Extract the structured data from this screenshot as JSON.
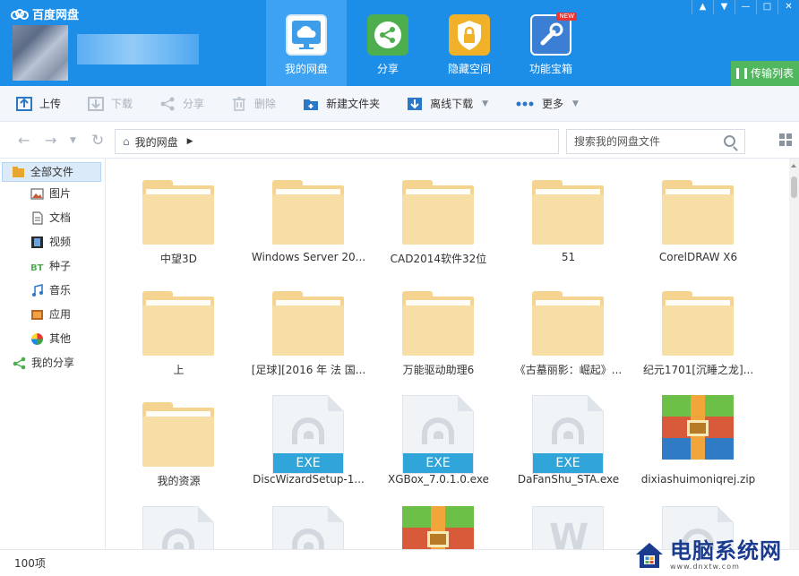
{
  "app": {
    "title": "百度网盘"
  },
  "nav": [
    {
      "label": "我的网盘",
      "icon": "cloud-icon",
      "active": true
    },
    {
      "label": "分享",
      "icon": "share-icon"
    },
    {
      "label": "隐藏空间",
      "icon": "lock-shield-icon"
    },
    {
      "label": "功能宝箱",
      "icon": "toolbox-icon",
      "badge": "NEW"
    }
  ],
  "window": {
    "transfer_label": "传输列表"
  },
  "toolbar": [
    {
      "label": "上传",
      "icon": "upload-icon",
      "enabled": true
    },
    {
      "label": "下载",
      "icon": "download-icon",
      "enabled": false
    },
    {
      "label": "分享",
      "icon": "share-icon",
      "enabled": false
    },
    {
      "label": "删除",
      "icon": "trash-icon",
      "enabled": false
    },
    {
      "label": "新建文件夹",
      "icon": "new-folder-icon",
      "enabled": true
    },
    {
      "label": "离线下载",
      "icon": "offline-download-icon",
      "enabled": true
    },
    {
      "label": "更多",
      "icon": "more-icon",
      "enabled": true
    }
  ],
  "breadcrumb": {
    "current": "我的网盘"
  },
  "search": {
    "placeholder": "搜索我的网盘文件"
  },
  "sidebar": [
    {
      "label": "全部文件",
      "icon": "all-files-icon",
      "level": "top",
      "selected": true
    },
    {
      "label": "图片",
      "icon": "image-icon",
      "level": "sub"
    },
    {
      "label": "文档",
      "icon": "document-icon",
      "level": "sub"
    },
    {
      "label": "视频",
      "icon": "video-icon",
      "level": "sub"
    },
    {
      "label": "种子",
      "icon": "bt-icon",
      "level": "sub"
    },
    {
      "label": "音乐",
      "icon": "music-icon",
      "level": "sub"
    },
    {
      "label": "应用",
      "icon": "app-icon",
      "level": "sub"
    },
    {
      "label": "其他",
      "icon": "other-icon",
      "level": "sub"
    },
    {
      "label": "我的分享",
      "icon": "my-share-icon",
      "level": "top"
    }
  ],
  "files": [
    {
      "name": "中望3D",
      "type": "folder"
    },
    {
      "name": "Windows Server 20...",
      "type": "folder"
    },
    {
      "name": "CAD2014软件32位",
      "type": "folder"
    },
    {
      "name": "51",
      "type": "folder"
    },
    {
      "name": "CorelDRAW X6",
      "type": "folder"
    },
    {
      "name": "上",
      "type": "folder"
    },
    {
      "name": "[足球][2016 年 法 国...",
      "type": "folder"
    },
    {
      "name": "万能驱动助理6",
      "type": "folder"
    },
    {
      "name": "《古墓丽影：崛起》...",
      "type": "folder"
    },
    {
      "name": "纪元1701[沉睡之龙]...",
      "type": "folder"
    },
    {
      "name": "我的资源",
      "type": "folder"
    },
    {
      "name": "DiscWizardSetup-1...",
      "type": "exe",
      "badge": "EXE"
    },
    {
      "name": "XGBox_7.0.1.0.exe",
      "type": "exe",
      "badge": "EXE"
    },
    {
      "name": "DaFanShu_STA.exe",
      "type": "exe",
      "badge": "EXE"
    },
    {
      "name": "dixiashuimoniqrej.zip",
      "type": "zip"
    },
    {
      "name": "",
      "type": "exe"
    },
    {
      "name": "",
      "type": "exe"
    },
    {
      "name": "",
      "type": "zip"
    },
    {
      "name": "",
      "type": "word"
    },
    {
      "name": "",
      "type": "exe"
    }
  ],
  "status": {
    "count": "100项"
  },
  "watermark": {
    "title": "电脑系统网",
    "url": "www.dnxtw.com"
  },
  "colors": {
    "topbar": "#1d8ee8",
    "nav_active": "#3da2f1",
    "transfer": "#51b75f",
    "folder": "#f4d490",
    "exe_band": "#2fa5d9"
  }
}
